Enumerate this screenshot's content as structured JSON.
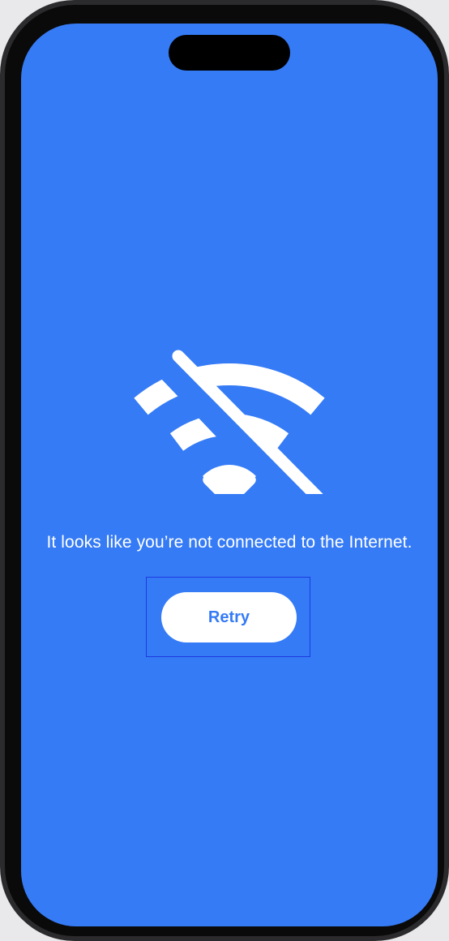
{
  "offline": {
    "icon": "wifi-slash-icon",
    "message": "It looks like you’re not connected to the Internet.",
    "retry_label": "Retry"
  },
  "colors": {
    "background": "#357bf6",
    "foreground": "#ffffff",
    "button_text": "#357bf6",
    "focus_ring": "#1d3ae0"
  }
}
